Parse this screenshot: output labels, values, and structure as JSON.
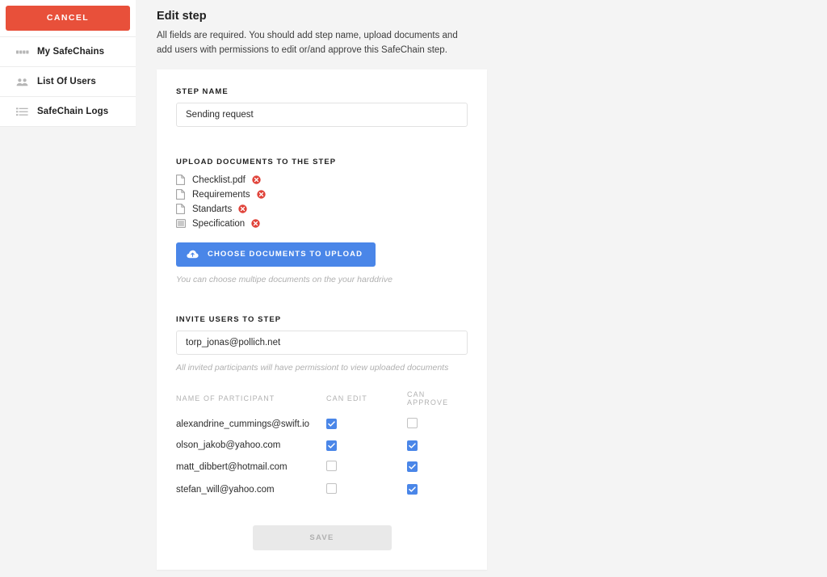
{
  "sidebar": {
    "cancel_label": "CANCEL",
    "items": [
      {
        "label": "My SafeChains",
        "icon": "chain-links-icon"
      },
      {
        "label": "List Of Users",
        "icon": "users-icon"
      },
      {
        "label": "SafeChain Logs",
        "icon": "list-lines-icon"
      }
    ]
  },
  "header": {
    "title": "Edit step",
    "subtitle": "All fields are required. You should add step name, upload documents and add users with permissions to edit or/and approve this SafeChain step."
  },
  "step_name": {
    "label": "STEP NAME",
    "value": "Sending request",
    "placeholder": "Step name"
  },
  "documents": {
    "label": "UPLOAD DOCUMENTS TO THE STEP",
    "items": [
      {
        "name": "Checklist.pdf",
        "icon": "file-icon",
        "remove_icon": "remove-circle-icon"
      },
      {
        "name": "Requirements",
        "icon": "file-icon",
        "remove_icon": "remove-circle-icon"
      },
      {
        "name": "Standarts",
        "icon": "file-icon",
        "remove_icon": "remove-circle-icon"
      },
      {
        "name": "Specification",
        "icon": "image-file-icon",
        "remove_icon": "remove-circle-icon"
      }
    ],
    "upload_button_label": "CHOOSE DOCUMENTS TO UPLOAD",
    "upload_button_icon": "cloud-upload-icon",
    "hint": "You can choose multipe documents on the your harddrive"
  },
  "invite": {
    "label": "INVITE USERS TO STEP",
    "value": "torp_jonas@pollich.net",
    "placeholder": "Enter email",
    "hint": "All invited participants will have permissiont to view uploaded documents"
  },
  "participants": {
    "columns": [
      "NAME OF PARTICIPANT",
      "CAN EDIT",
      "CAN APPROVE"
    ],
    "rows": [
      {
        "name": "alexandrine_cummings@swift.io",
        "can_edit": true,
        "can_approve": false
      },
      {
        "name": "olson_jakob@yahoo.com",
        "can_edit": true,
        "can_approve": true
      },
      {
        "name": "matt_dibbert@hotmail.com",
        "can_edit": false,
        "can_approve": true
      },
      {
        "name": "stefan_will@yahoo.com",
        "can_edit": false,
        "can_approve": true
      }
    ]
  },
  "footer": {
    "save_label": "SAVE"
  },
  "colors": {
    "cancel_red": "#e8503a",
    "accent_blue": "#4a86e8",
    "remove_red": "#e0433a",
    "page_bg": "#f4f4f4",
    "card_bg": "#ffffff",
    "disabled_gray": "#e9e9e9"
  }
}
